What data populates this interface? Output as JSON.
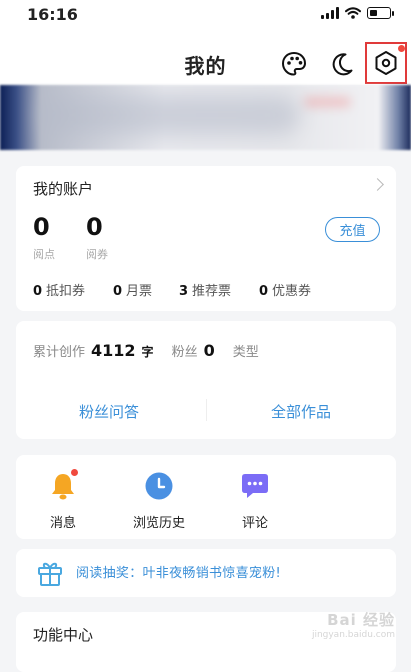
{
  "status_bar": {
    "time": "16:16"
  },
  "header": {
    "title": "我的"
  },
  "account": {
    "title": "我的账户",
    "reading_points": {
      "value": "0",
      "label": "阅点"
    },
    "vouchers": {
      "value": "0",
      "label": "阅券"
    },
    "recharge_label": "充值",
    "stats": [
      {
        "value": "0",
        "label": "抵扣券"
      },
      {
        "value": "0",
        "label": "月票"
      },
      {
        "value": "3",
        "label": "推荐票"
      },
      {
        "value": "0",
        "label": "优惠券"
      }
    ]
  },
  "creator": {
    "total_label": "累计创作",
    "total_value": "4112",
    "total_unit": "字",
    "fans_label": "粉丝",
    "fans_value": "0",
    "type_label": "类型",
    "fan_qa_label": "粉丝问答",
    "all_works_label": "全部作品"
  },
  "shortcuts": [
    {
      "label": "消息",
      "icon": "bell-icon"
    },
    {
      "label": "浏览历史",
      "icon": "clock-icon"
    },
    {
      "label": "评论",
      "icon": "comment-icon"
    }
  ],
  "promo": {
    "text": "阅读抽奖：叶非夜畅销书惊喜宠粉!",
    "icon": "gift-icon"
  },
  "function_center": {
    "title": "功能中心"
  },
  "watermark": {
    "line1": "Bai 经验",
    "line2": "jingyan.baidu.com"
  },
  "colors": {
    "accent": "#3a8fd8",
    "highlight_box": "#e03a3a",
    "badge": "#f0493e",
    "bell": "#f5a623",
    "clock": "#4a90e2",
    "comment": "#7b6cf6",
    "gift": "#4aa8e0"
  }
}
